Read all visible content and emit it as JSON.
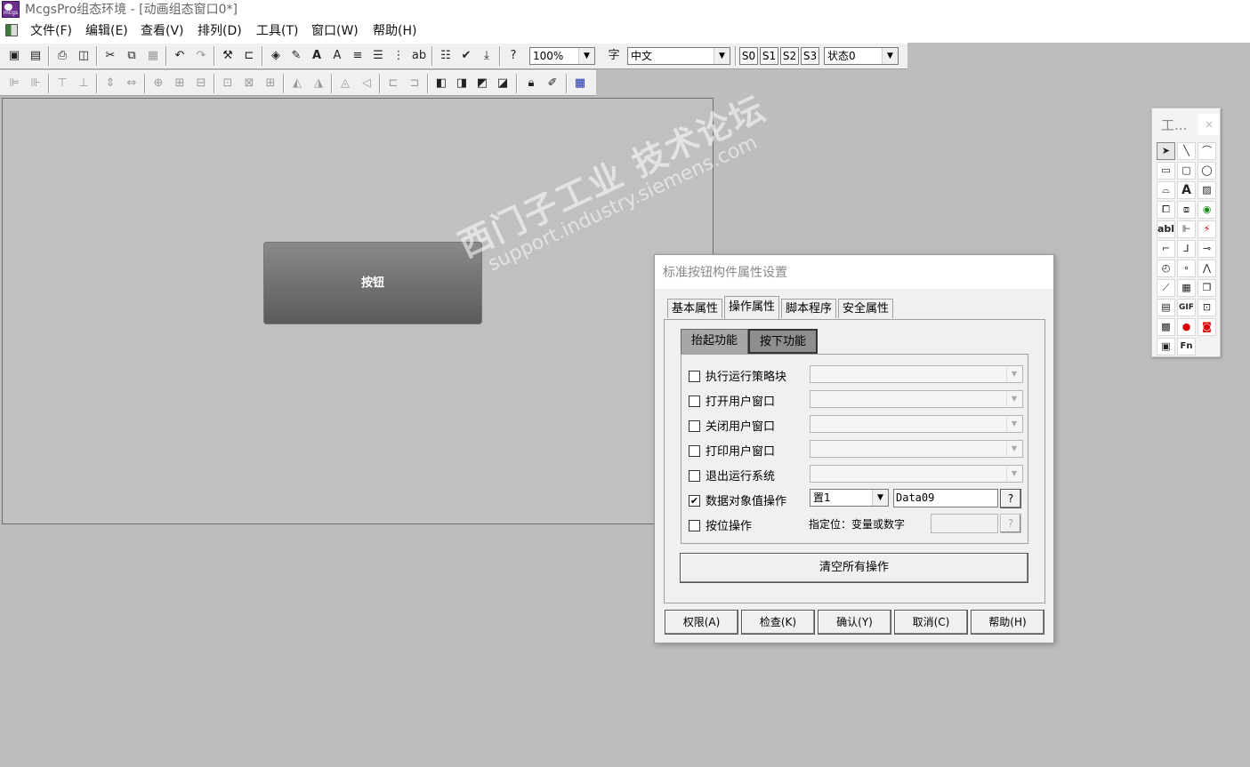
{
  "window": {
    "title": "McgsPro组态环境 - [动画组态窗口0*]",
    "app_icon_text": "mcgs"
  },
  "menubar": {
    "items": [
      "文件(F)",
      "编辑(E)",
      "查看(V)",
      "排列(D)",
      "工具(T)",
      "窗口(W)",
      "帮助(H)"
    ]
  },
  "toolbar": {
    "zoom": "100%",
    "language": "中文",
    "states": [
      "S0",
      "S1",
      "S2",
      "S3"
    ],
    "state_select": "状态0"
  },
  "canvas": {
    "button_label": "按钮"
  },
  "toolbox": {
    "title": "工...",
    "close": "×"
  },
  "dialog": {
    "title": "标准按钮构件属性设置",
    "tabs": [
      "基本属性",
      "操作属性",
      "脚本程序",
      "安全属性"
    ],
    "subtabs": [
      "抬起功能",
      "按下功能"
    ],
    "rows": [
      {
        "label": "执行运行策略块",
        "checked": false
      },
      {
        "label": "打开用户窗口",
        "checked": false
      },
      {
        "label": "关闭用户窗口",
        "checked": false
      },
      {
        "label": "打印用户窗口",
        "checked": false
      },
      {
        "label": "退出运行系统",
        "checked": false
      },
      {
        "label": "数据对象值操作",
        "checked": true,
        "op": "置1",
        "var": "Data09",
        "help": "?"
      },
      {
        "label": "按位操作",
        "checked": false,
        "hint": "指定位：变量或数字",
        "help": "?"
      }
    ],
    "clear_all": "清空所有操作",
    "buttons": [
      "权限(A)",
      "检查(K)",
      "确认(Y)",
      "取消(C)",
      "帮助(H)"
    ]
  },
  "watermark": {
    "main": "西门子工业 技术论坛",
    "sub": "support.industry.siemens.com"
  }
}
